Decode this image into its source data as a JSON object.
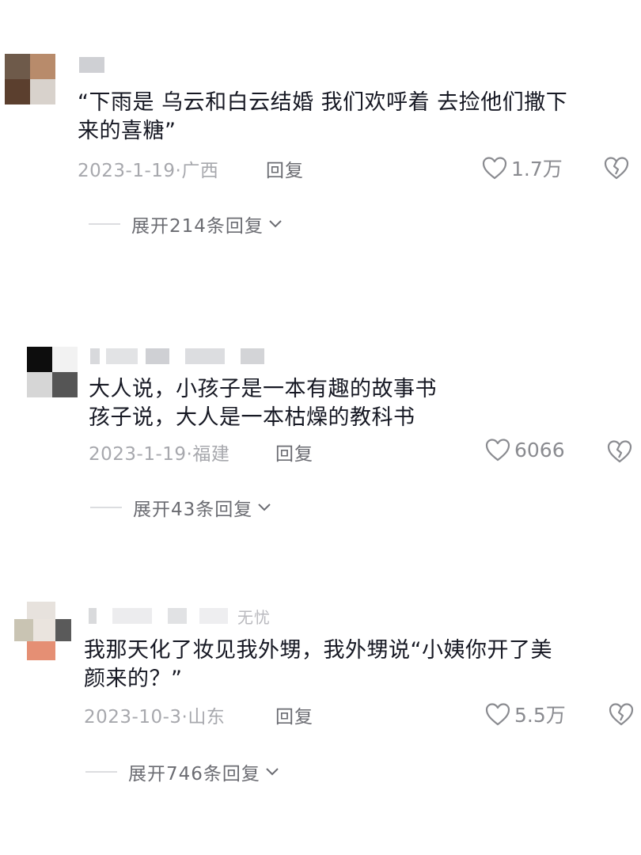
{
  "comments": [
    {
      "name_tail": "",
      "text": "“下雨是 乌云和白云结婚 我们欢呼着 去捡他们撒下\n来的喜糖”",
      "date": "2023-1-19",
      "location": "广西",
      "reply_label": "回复",
      "likes": "1.7万",
      "expand_label": "展开214条回复"
    },
    {
      "name_tail": "",
      "text": "大人说，小孩子是一本有趣的故事书\n孩子说，大人是一本枯燥的教科书",
      "date": "2023-1-19",
      "location": "福建",
      "reply_label": "回复",
      "likes": "6066",
      "expand_label": "展开43条回复"
    },
    {
      "name_tail": "无忧",
      "text": "我那天化了妆见我外甥，我外甥说“小姨你开了美\n颜来的？”",
      "date": "2023-10-3",
      "location": "山东",
      "reply_label": "回复",
      "likes": "5.5万",
      "expand_label": "展开746条回复"
    }
  ],
  "colors": {
    "text": "#161823",
    "meta": "#a7a8ad",
    "action": "#6b6c72"
  },
  "icons": {
    "like": "heart-outline-icon",
    "dislike": "broken-heart-icon",
    "expand": "chevron-down-icon"
  }
}
